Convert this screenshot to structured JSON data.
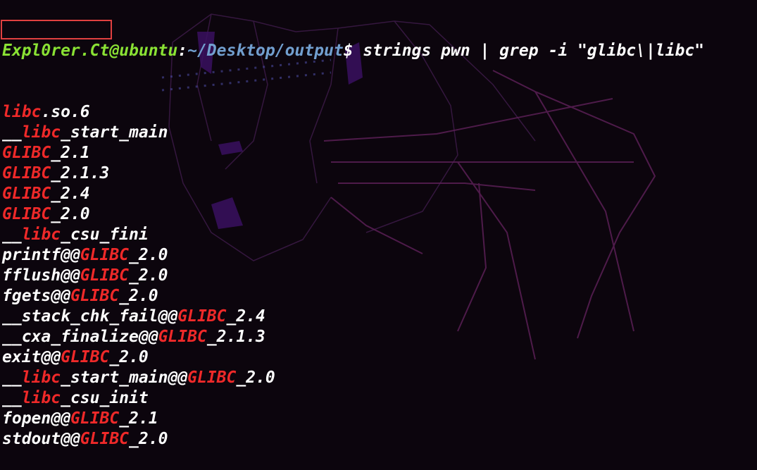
{
  "prompt": {
    "user_host": "Expl0rer.Ct@ubuntu",
    "separator": ":",
    "path": "~/Desktop/output",
    "symbol": "$",
    "command": " strings pwn | grep -i \"glibc\\|libc\""
  },
  "output_lines": [
    [
      {
        "t": "libc",
        "m": true
      },
      {
        "t": ".so.6",
        "m": false
      }
    ],
    [
      {
        "t": "__",
        "m": false
      },
      {
        "t": "libc",
        "m": true
      },
      {
        "t": "_start_main",
        "m": false
      }
    ],
    [
      {
        "t": "GLIBC",
        "m": true
      },
      {
        "t": "_2.1",
        "m": false
      }
    ],
    [
      {
        "t": "GLIBC",
        "m": true
      },
      {
        "t": "_2.1.3",
        "m": false
      }
    ],
    [
      {
        "t": "GLIBC",
        "m": true
      },
      {
        "t": "_2.4",
        "m": false
      }
    ],
    [
      {
        "t": "GLIBC",
        "m": true
      },
      {
        "t": "_2.0",
        "m": false
      }
    ],
    [
      {
        "t": "__",
        "m": false
      },
      {
        "t": "libc",
        "m": true
      },
      {
        "t": "_csu_fini",
        "m": false
      }
    ],
    [
      {
        "t": "printf@@",
        "m": false
      },
      {
        "t": "GLIBC",
        "m": true
      },
      {
        "t": "_2.0",
        "m": false
      }
    ],
    [
      {
        "t": "fflush@@",
        "m": false
      },
      {
        "t": "GLIBC",
        "m": true
      },
      {
        "t": "_2.0",
        "m": false
      }
    ],
    [
      {
        "t": "fgets@@",
        "m": false
      },
      {
        "t": "GLIBC",
        "m": true
      },
      {
        "t": "_2.0",
        "m": false
      }
    ],
    [
      {
        "t": "__stack_chk_fail@@",
        "m": false
      },
      {
        "t": "GLIBC",
        "m": true
      },
      {
        "t": "_2.4",
        "m": false
      }
    ],
    [
      {
        "t": "__cxa_finalize@@",
        "m": false
      },
      {
        "t": "GLIBC",
        "m": true
      },
      {
        "t": "_2.1.3",
        "m": false
      }
    ],
    [
      {
        "t": "exit@@",
        "m": false
      },
      {
        "t": "GLIBC",
        "m": true
      },
      {
        "t": "_2.0",
        "m": false
      }
    ],
    [
      {
        "t": "__",
        "m": false
      },
      {
        "t": "libc",
        "m": true
      },
      {
        "t": "_start_main@@",
        "m": false
      },
      {
        "t": "GLIBC",
        "m": true
      },
      {
        "t": "_2.0",
        "m": false
      }
    ],
    [
      {
        "t": "__",
        "m": false
      },
      {
        "t": "libc",
        "m": true
      },
      {
        "t": "_csu_init",
        "m": false
      }
    ],
    [
      {
        "t": "fopen@@",
        "m": false
      },
      {
        "t": "GLIBC",
        "m": true
      },
      {
        "t": "_2.1",
        "m": false
      }
    ],
    [
      {
        "t": "stdout@@",
        "m": false
      },
      {
        "t": "GLIBC",
        "m": true
      },
      {
        "t": "_2.0",
        "m": false
      }
    ]
  ],
  "colors": {
    "background": "#0c050d",
    "prompt_user": "#8ae234",
    "prompt_path": "#729fcf",
    "match": "#ef2929",
    "text": "#ffffff",
    "annotation_box": "#e04040"
  }
}
